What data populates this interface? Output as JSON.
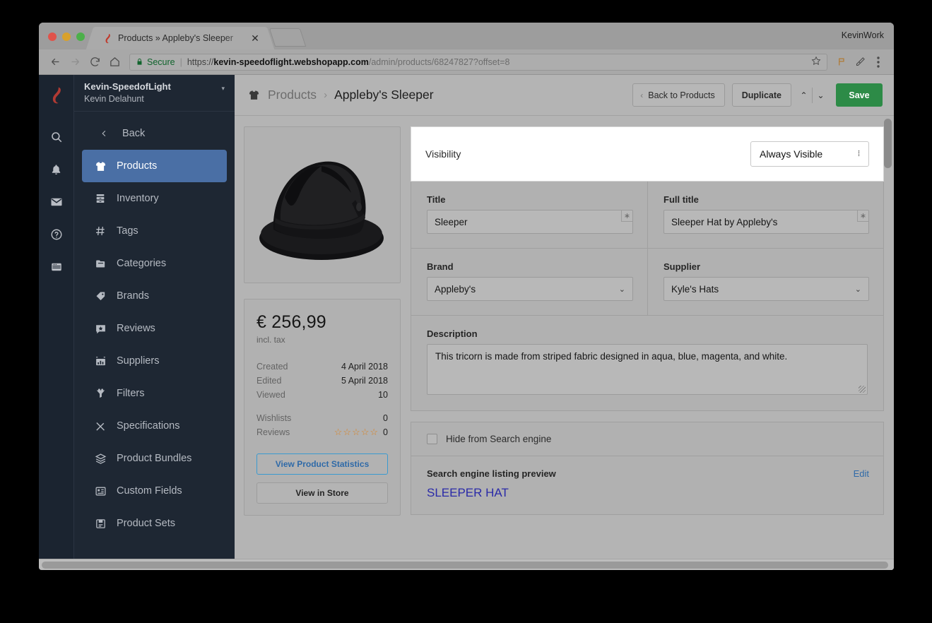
{
  "browser": {
    "window_label": "KevinWork",
    "tab": {
      "title": "Products » Appleby's Sleeper",
      "close": "✕"
    },
    "url": {
      "secure_label": "Secure",
      "separator": "|",
      "scheme": "https://",
      "host": "kevin-speedoflight.webshopapp.com",
      "path": "/admin/products/68247827?offset=8"
    },
    "nav": {
      "back": "←",
      "forward": "→",
      "reload": "⟳",
      "home": "⌂"
    }
  },
  "rail": {
    "items": [
      {
        "name": "logo",
        "icon": "lightspeed-flame-icon"
      },
      {
        "name": "search",
        "icon": "search-icon"
      },
      {
        "name": "notifications",
        "icon": "bell-icon"
      },
      {
        "name": "messages",
        "icon": "mail-icon"
      },
      {
        "name": "help",
        "icon": "question-circle-icon"
      },
      {
        "name": "store",
        "icon": "browser-window-icon"
      }
    ]
  },
  "sidebar": {
    "shop_name": "Kevin-SpeedofLight",
    "user_name": "Kevin Delahunt",
    "caret": "▾",
    "back_label": "Back",
    "items": [
      {
        "label": "Products",
        "icon": "shirt-icon",
        "active": true
      },
      {
        "label": "Inventory",
        "icon": "drawers-icon",
        "active": false
      },
      {
        "label": "Tags",
        "icon": "hash-icon",
        "active": false
      },
      {
        "label": "Categories",
        "icon": "folder-icon",
        "active": false
      },
      {
        "label": "Brands",
        "icon": "tag-icon",
        "active": false
      },
      {
        "label": "Reviews",
        "icon": "comment-star-icon",
        "active": false
      },
      {
        "label": "Suppliers",
        "icon": "storefront-icon",
        "active": false
      },
      {
        "label": "Filters",
        "icon": "funnel-icon",
        "active": false
      },
      {
        "label": "Specifications",
        "icon": "ruler-pencil-icon",
        "active": false
      },
      {
        "label": "Product Bundles",
        "icon": "layers-icon",
        "active": false
      },
      {
        "label": "Custom Fields",
        "icon": "list-box-icon",
        "active": false
      },
      {
        "label": "Product Sets",
        "icon": "set-icon",
        "active": false
      }
    ]
  },
  "topbar": {
    "breadcrumb_root": "Products",
    "breadcrumb_sep": "›",
    "breadcrumb_current": "Appleby's Sleeper",
    "back_to_products": "Back to Products",
    "back_chevron": "‹",
    "duplicate": "Duplicate",
    "prev_arrow": "⌃",
    "next_arrow": "⌄",
    "save": "Save",
    "save_color": "#2d8b47"
  },
  "product_card": {
    "image_alt": "black fedora hat",
    "price": "€ 256,99",
    "price_note": "incl. tax",
    "stats": [
      {
        "key": "Created",
        "value": "4 April 2018"
      },
      {
        "key": "Edited",
        "value": "5 April 2018"
      },
      {
        "key": "Viewed",
        "value": "10"
      }
    ],
    "stats2": [
      {
        "key": "Wishlists",
        "value": "0"
      },
      {
        "key": "Reviews",
        "value": "0",
        "stars": "☆☆☆☆☆"
      }
    ],
    "btn_statistics": "View Product Statistics",
    "btn_store": "View in Store",
    "stats_btn_color": "#2f6aa8"
  },
  "form": {
    "visibility_label": "Visibility",
    "visibility_value": "Always Visible",
    "visibility_arrows": "⁞",
    "title_label": "Title",
    "title_value": "Sleeper",
    "title_required": "∗",
    "fulltitle_label": "Full title",
    "fulltitle_value": "Sleeper Hat by Appleby's",
    "fulltitle_required": "∗",
    "brand_label": "Brand",
    "brand_value": "Appleby's",
    "supplier_label": "Supplier",
    "supplier_value": "Kyle's Hats",
    "chevron": "⌄",
    "description_label": "Description",
    "description_value": "This tricorn is made from striped fabric designed in aqua, blue, magenta, and white."
  },
  "seo": {
    "hide_label": "Hide from Search engine",
    "hide_checked": false,
    "preview_heading": "Search engine listing preview",
    "edit_label": "Edit",
    "preview_title": "SLEEPER HAT",
    "link_color": "#2a2aa8"
  }
}
